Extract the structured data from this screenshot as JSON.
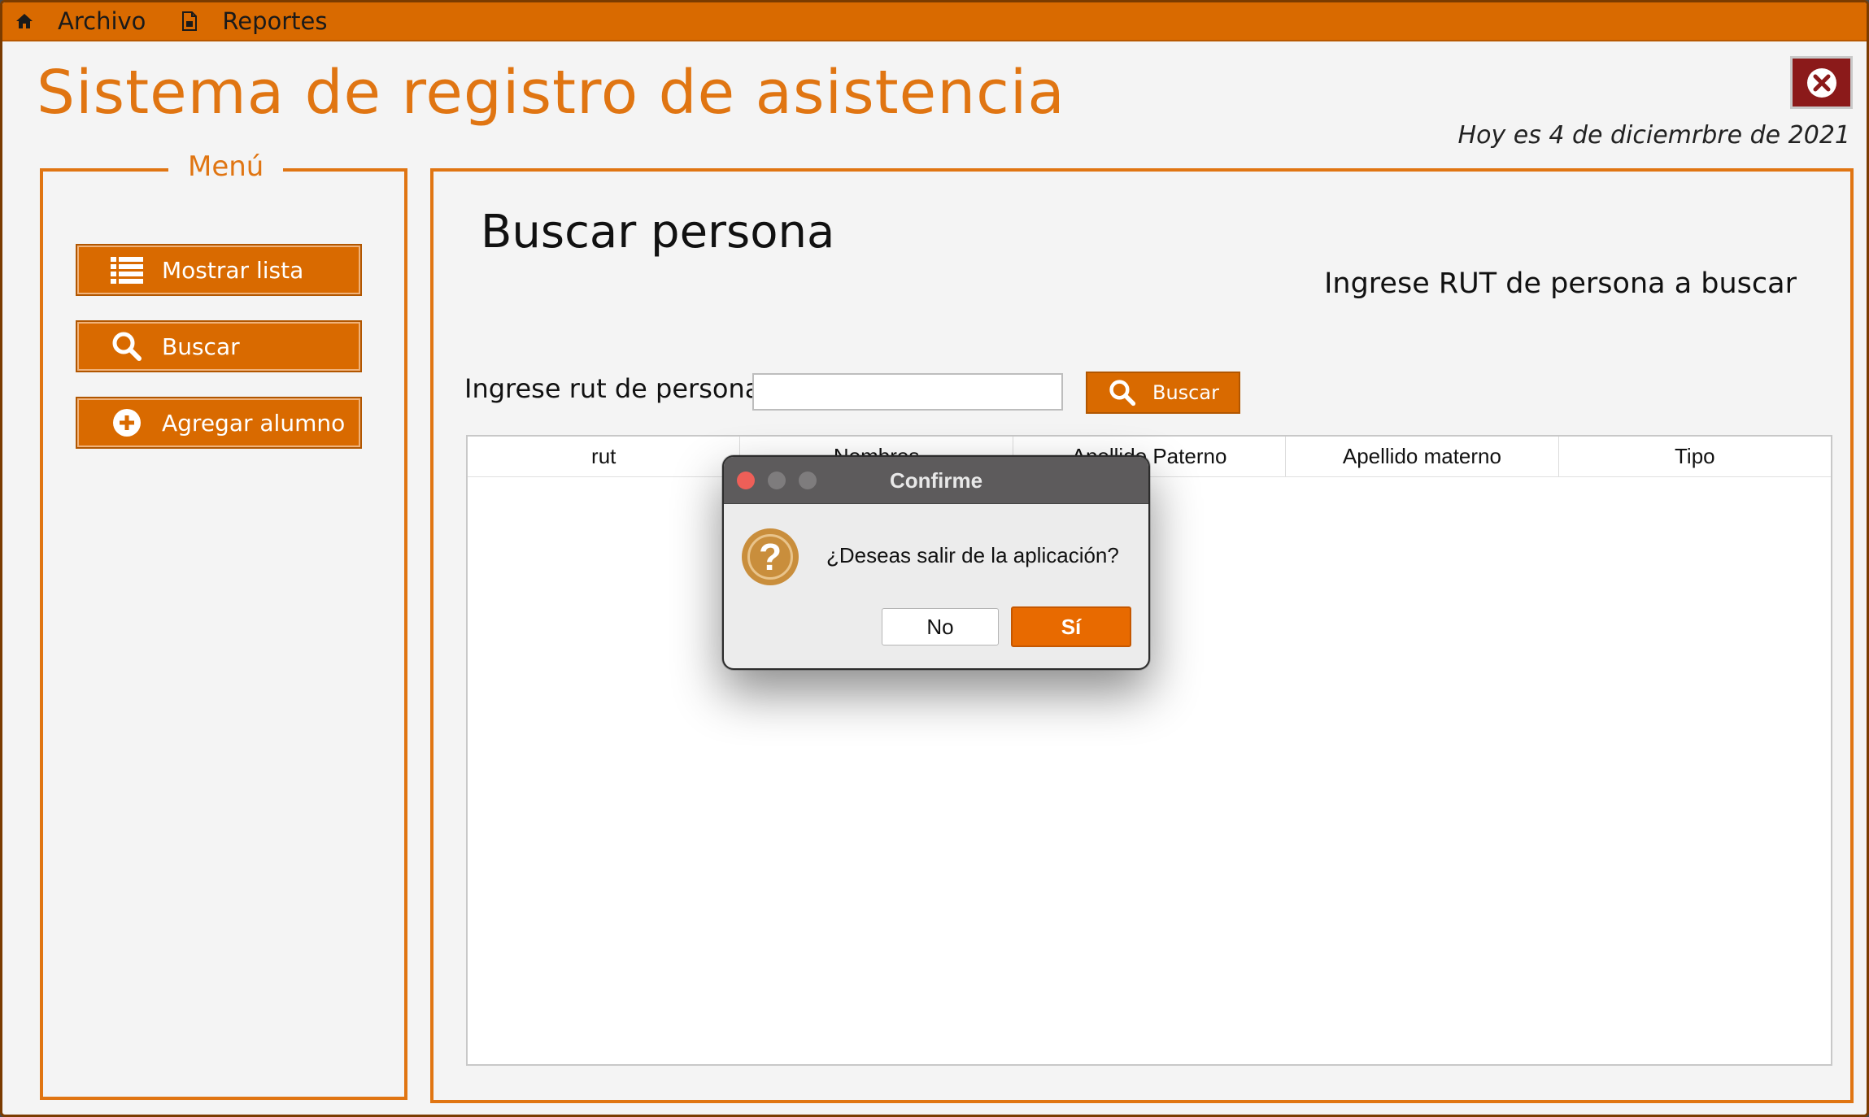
{
  "menubar": {
    "items": [
      {
        "label": "Archivo",
        "icon": "home-icon"
      },
      {
        "label": "Reportes",
        "icon": "document-icon"
      }
    ]
  },
  "app": {
    "title": "Sistema de registro de asistencia",
    "date": "Hoy es 4 de diciemrbre de 2021",
    "close_icon": "close-circle-icon"
  },
  "menu": {
    "legend": "Menú",
    "buttons": [
      {
        "label": "Mostrar lista",
        "icon": "list-icon"
      },
      {
        "label": "Buscar",
        "icon": "search-icon"
      },
      {
        "label": "Agregar alumno",
        "icon": "plus-circle-icon"
      }
    ]
  },
  "content": {
    "title": "Buscar persona",
    "subtitle": "Ingrese RUT de persona a buscar",
    "rut_label": "Ingrese rut de persona",
    "rut_value": "",
    "search_button": "Buscar"
  },
  "table": {
    "columns": [
      "rut",
      "Nombres",
      "Apellido Paterno",
      "Apellido materno",
      "Tipo"
    ],
    "rows": []
  },
  "dialog": {
    "title": "Confirme",
    "message": "¿Deseas salir de la aplicación?",
    "no_label": "No",
    "yes_label": "Sí",
    "icon": "question-icon",
    "icon_glyph": "?"
  },
  "colors": {
    "accent": "#d96a00",
    "title": "#e07512",
    "dialog_titlebar": "#5d5b5c"
  }
}
